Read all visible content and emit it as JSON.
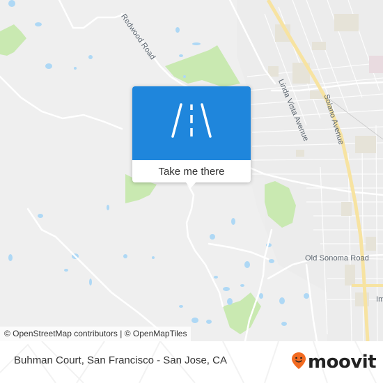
{
  "map": {
    "street_labels": [
      {
        "name": "redwood-road",
        "text": "Redwood Road"
      },
      {
        "name": "linda-vista-avenue",
        "text": "Linda Vista Avenue"
      },
      {
        "name": "solano-avenue",
        "text": "Solano Avenue"
      },
      {
        "name": "old-sonoma-road",
        "text": "Old Sonoma Road"
      },
      {
        "name": "partial-label-im",
        "text": "Im"
      }
    ],
    "attribution": "© OpenStreetMap contributors | © OpenMapTiles",
    "colors": {
      "land": "#efefef",
      "park": "#c9e9b1",
      "water": "#aed8f5",
      "highway": "#f7e3a1",
      "urban": "#e6e3d8"
    }
  },
  "popup": {
    "icon": "road-icon",
    "action_label": "Take me there",
    "accent_color": "#1f86dc"
  },
  "footer": {
    "location_title": "Buhman Court, San Francisco - San Jose, CA",
    "brand": "moovit",
    "brand_color": "#f26b21"
  }
}
